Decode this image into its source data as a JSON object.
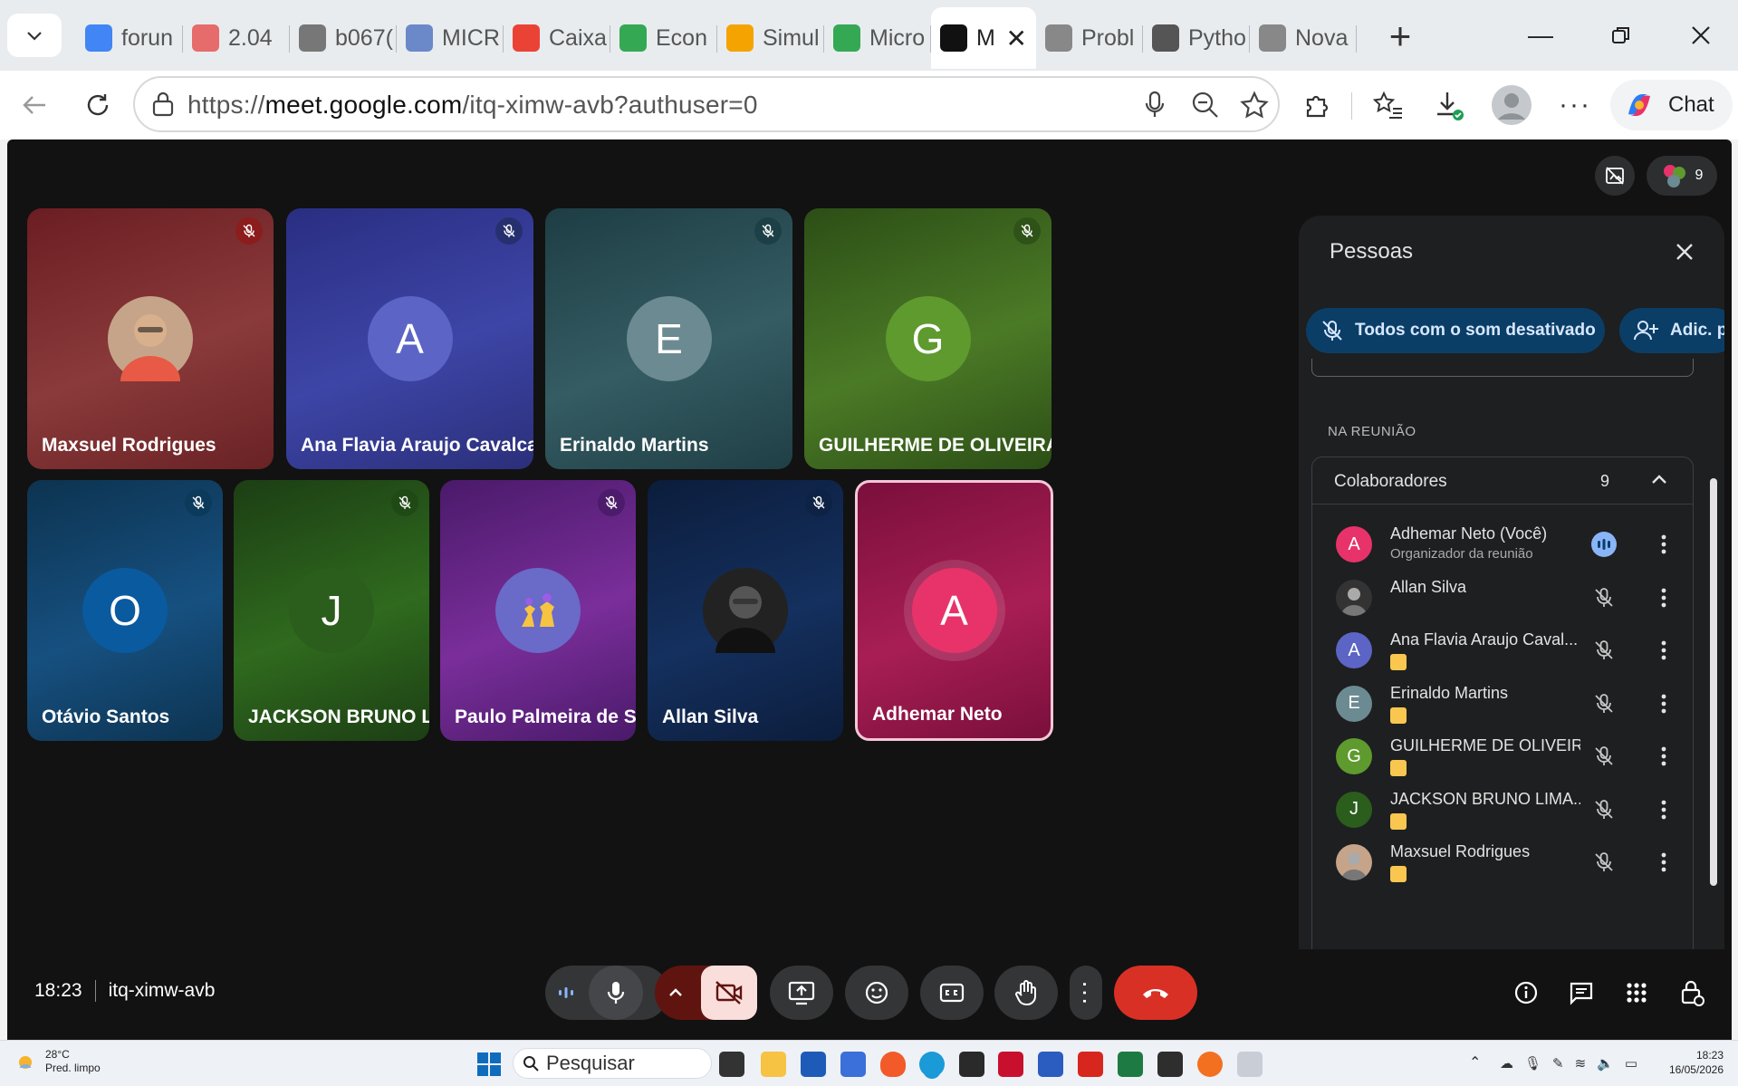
{
  "browser": {
    "tabs": [
      {
        "label": "forun",
        "icon": "google-icon",
        "color": "#4285f4"
      },
      {
        "label": "2.04",
        "icon": "canvas-icon",
        "color": "#e66b6b"
      },
      {
        "label": "b067(",
        "icon": "file-icon",
        "color": "#777777"
      },
      {
        "label": "MICR",
        "icon": "classroom-icon",
        "color": "#6b88c9"
      },
      {
        "label": "Caixa",
        "icon": "gmail-icon",
        "color": "#ea4335"
      },
      {
        "label": "Econ",
        "icon": "drive-icon",
        "color": "#34a853"
      },
      {
        "label": "Simul",
        "icon": "co-icon",
        "color": "#f4a300"
      },
      {
        "label": "Micro",
        "icon": "drive-icon",
        "color": "#34a853"
      },
      {
        "label": "M",
        "icon": "meet-record-icon",
        "color": "#111111",
        "active": true
      },
      {
        "label": "Probl",
        "icon": "openai-icon",
        "color": "#888888"
      },
      {
        "label": "Pytho",
        "icon": "python-icon",
        "color": "#555555"
      },
      {
        "label": "Nova",
        "icon": "newtab-icon",
        "color": "#888888"
      }
    ],
    "url_prefix": "https://",
    "url_domain": "meet.google.com",
    "url_path": "/itq-ximw-avb?authuser=0",
    "chat_label": "Chat"
  },
  "meet": {
    "participant_count": "9",
    "tiles": [
      {
        "name": "Maxsuel Rodrigues",
        "initial": "",
        "avatar": "photo-avatar",
        "bg": "linear-gradient(160deg,#6b1d22,#8a3a3a 55%,#6a2225)",
        "avatar_color": "#c5a48a",
        "mute_color": "#8c1d1d"
      },
      {
        "name": "Ana Flavia Araujo Cavalcante",
        "initial": "A",
        "avatar": "letter-avatar",
        "bg": "linear-gradient(160deg,#2a2e82,#3d45a6 55%,#2b2f7a)",
        "avatar_color": "#5c65c5",
        "mute_color": "#27306e"
      },
      {
        "name": "Erinaldo Martins",
        "initial": "E",
        "avatar": "letter-avatar",
        "bg": "linear-gradient(160deg,#1e3d44,#355c63 55%,#1f3f45)",
        "avatar_color": "#6c8a92",
        "mute_color": "#1d4047"
      },
      {
        "name": "GUILHERME DE OLIVEIRA C...",
        "initial": "G",
        "avatar": "letter-avatar",
        "bg": "linear-gradient(160deg,#2c4e16,#4b7a26 55%,#2c4e16)",
        "avatar_color": "#5e9a2e",
        "mute_color": "#2e5217"
      },
      {
        "name": "Otávio Santos",
        "initial": "O",
        "avatar": "letter-avatar",
        "bg": "linear-gradient(160deg,#0d3350,#165080 55%,#0d3350)",
        "avatar_color": "#0a5aa0",
        "mute_color": "#0b3a5a"
      },
      {
        "name": "JACKSON BRUNO LI...",
        "initial": "J",
        "avatar": "letter-avatar",
        "bg": "linear-gradient(160deg,#1c3e14,#2f6a1e 55%,#1c3e14)",
        "avatar_color": "#2b5d1c",
        "mute_color": "#1f4a16"
      },
      {
        "name": "Paulo Palmeira de So...",
        "initial": "",
        "avatar": "chess-avatar",
        "bg": "linear-gradient(160deg,#4a1a6a,#7a2e9a 55%,#4a1a6a)",
        "avatar_color": "#6a6ac8",
        "mute_color": "#4c1b6c"
      },
      {
        "name": "Allan Silva",
        "initial": "",
        "avatar": "photo-avatar",
        "bg": "linear-gradient(160deg,#0c1d3c,#14305e 55%,#0c1d3c)",
        "avatar_color": "#222222",
        "mute_color": "#0d2244"
      },
      {
        "name": "Adhemar Neto",
        "initial": "A",
        "avatar": "letter-avatar",
        "bg": "linear-gradient(160deg,#7a0f3c,#a81e54 55%,#7a0f3c)",
        "avatar_color": "#e8336a",
        "self": true
      }
    ],
    "people_panel": {
      "title": "Pessoas",
      "mute_all_label": "Todos com o som desativado",
      "add_label": "Adic. p",
      "section_label": "NA REUNIÃO",
      "group_label": "Colaboradores",
      "group_count": "9",
      "people": [
        {
          "name": "Adhemar Neto (Você)",
          "sub": "Organizador da reunião",
          "initial": "A",
          "color": "#e8336a",
          "speaking": true
        },
        {
          "name": "Allan Silva",
          "sub": "",
          "initial": "",
          "color": "#333333"
        },
        {
          "name": "Ana Flavia Araujo Caval...",
          "sub": "",
          "initial": "A",
          "color": "#5c65c5",
          "tag": true
        },
        {
          "name": "Erinaldo Martins",
          "sub": "",
          "initial": "E",
          "color": "#6c8a92",
          "tag": true
        },
        {
          "name": "GUILHERME DE OLIVEIR...",
          "sub": "",
          "initial": "G",
          "color": "#5e9a2e",
          "tag": true
        },
        {
          "name": "JACKSON BRUNO LIMA...",
          "sub": "",
          "initial": "J",
          "color": "#2b5d1c",
          "tag": true
        },
        {
          "name": "Maxsuel Rodrigues",
          "sub": "",
          "initial": "",
          "color": "#c5a48a",
          "tag": true
        }
      ]
    },
    "time": "18:23",
    "meeting_code": "itq-ximw-avb"
  },
  "taskbar": {
    "temperature": "28°C",
    "weather": "Pred. limpo",
    "search_placeholder": "Pesquisar",
    "time": "18:23",
    "date": "16/05/2026"
  }
}
